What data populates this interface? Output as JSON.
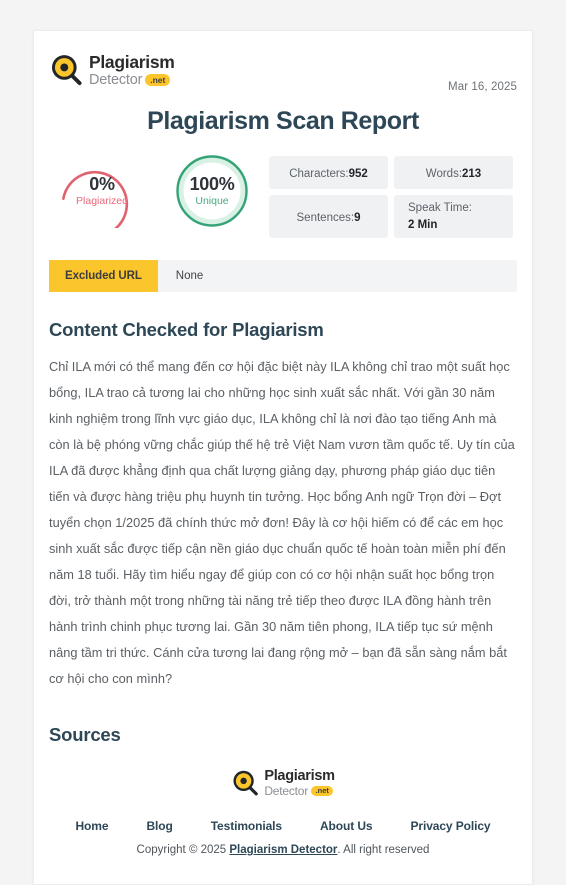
{
  "header": {
    "logo": {
      "icon": "magnifier-logo-icon",
      "word_top": "Plagiarism",
      "word_bottom": "Detector",
      "badge": ".net"
    },
    "date": "Mar 16, 2025"
  },
  "title": "Plagiarism Scan Report",
  "gauges": [
    {
      "name": "plagiarized",
      "value": "0%",
      "label": "Plagiarized",
      "percent": 0,
      "color": "#e0626f",
      "track_color": "#ffffff"
    },
    {
      "name": "unique",
      "value": "100%",
      "label": "Unique",
      "percent": 100,
      "color": "#35a376",
      "track_color": "#d9f0e5"
    }
  ],
  "stats": [
    {
      "label": "Characters:",
      "value": "952"
    },
    {
      "label": "Words:",
      "value": "213"
    },
    {
      "label": "Sentences:",
      "value": "9"
    },
    {
      "label": "Speak Time:",
      "value": "2 Min"
    }
  ],
  "excluded_url": {
    "tag": "Excluded URL",
    "value": "None"
  },
  "content": {
    "heading": "Content Checked for Plagiarism",
    "text": "Chỉ ILA mới có thể mang đến cơ hội đặc biệt này ILA không chỉ trao một suất học bổng, ILA trao cả tương lai cho những học sinh xuất sắc nhất. Với gần 30 năm kinh nghiệm trong lĩnh vực giáo dục, ILA không chỉ là nơi đào tạo tiếng Anh mà còn là bệ phóng vững chắc giúp thế hệ trẻ Việt Nam vươn tầm quốc tế. Uy tín của ILA đã được khẳng định qua chất lượng giảng dạy, phương pháp giáo dục tiên tiến và được hàng triệu phụ huynh tin tưởng. Học bổng Anh ngữ Trọn đời – Đợt tuyển chọn 1/2025 đã chính thức mở đơn! Đây là cơ hội hiếm có để các em học sinh xuất sắc được tiếp cận nền giáo dục chuẩn quốc tế hoàn toàn miễn phí đến năm 18 tuổi. Hãy tìm hiểu ngay để giúp con có cơ hội nhận suất học bổng trọn đời, trở thành một trong những tài năng trẻ tiếp theo được ILA đồng hành trên hành trình chinh phục tương lai. Gần 30 năm tiên phong, ILA tiếp tục sứ mệnh nâng tầm tri thức. Cánh cửa tương lai đang rộng mở – bạn đã sẵn sàng nắm bắt cơ hội cho con mình?"
  },
  "sources": {
    "heading": "Sources",
    "items": []
  },
  "footer": {
    "logo": {
      "icon": "magnifier-logo-icon",
      "word_top": "Plagiarism",
      "word_bottom": "Detector",
      "badge": ".net"
    },
    "nav": [
      {
        "label": "Home"
      },
      {
        "label": "Blog"
      },
      {
        "label": "Testimonials"
      },
      {
        "label": "About Us"
      },
      {
        "label": "Privacy Policy"
      }
    ],
    "copyright_prefix": "Copyright © 2025 ",
    "copyright_brand": "Plagiarism Detector",
    "copyright_suffix": ". All right reserved"
  },
  "colors": {
    "brand_yellow": "#fbc52c",
    "heading_blue": "#2e4756",
    "plagiarized_red": "#e0626f",
    "unique_green": "#35a376",
    "page_bg": "#f4f4f5"
  }
}
